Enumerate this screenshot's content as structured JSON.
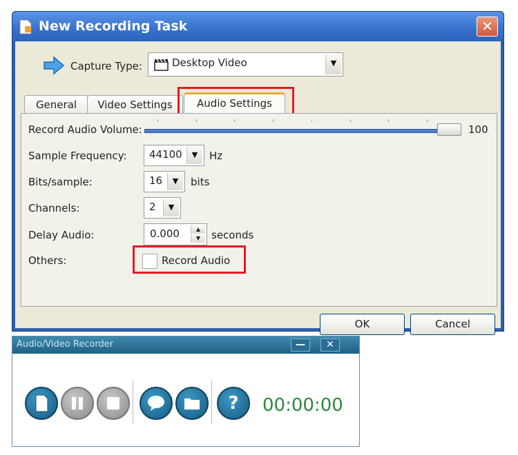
{
  "dialog": {
    "title": "New Recording Task",
    "capture_type_label": "Capture Type:",
    "capture_type_value": "Desktop Video",
    "tabs": [
      "General",
      "Video Settings",
      "Audio Settings"
    ],
    "active_tab": "Audio Settings",
    "audio": {
      "volume_label": "Record Audio Volume:",
      "volume_value": "100",
      "sample_frequency_label": "Sample Frequency:",
      "sample_frequency_value": "44100",
      "sample_frequency_unit": "Hz",
      "bits_label": "Bits/sample:",
      "bits_value": "16",
      "bits_unit": "bits",
      "channels_label": "Channels:",
      "channels_value": "2",
      "delay_label": "Delay Audio:",
      "delay_value": "0.000",
      "delay_unit": "seconds",
      "others_label": "Others:",
      "record_audio_label": "Record Audio",
      "record_audio_checked": false
    },
    "ok_label": "OK",
    "cancel_label": "Cancel"
  },
  "recorder": {
    "title": "Audio/Video Recorder",
    "minimize_glyph": "—",
    "close_glyph": "✕",
    "timer": "00:00:00",
    "buttons": [
      "new-icon",
      "pause-icon",
      "stop-icon",
      "comment-icon",
      "folder-icon",
      "help-icon"
    ],
    "help_glyph": "?"
  },
  "colors": {
    "title_blue": "#3a73cf",
    "highlight_red": "#e31c23",
    "timer_green": "#2b8a3e",
    "recorder_bar": "#1f5f85"
  }
}
